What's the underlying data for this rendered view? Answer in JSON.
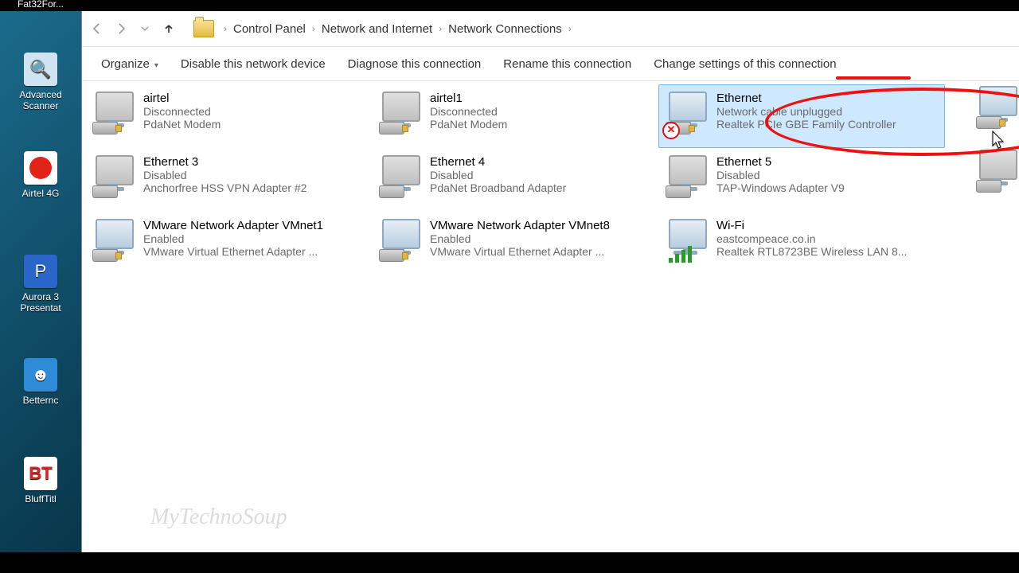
{
  "desktop_icons": [
    {
      "label": "Fat32For..."
    },
    {
      "label": "Advanced Scanner"
    },
    {
      "label": "Airtel 4G"
    },
    {
      "label": "Aurora 3 Presentat"
    },
    {
      "label": "Betternc"
    },
    {
      "label": "BluffTitl"
    }
  ],
  "breadcrumbs": [
    "Control Panel",
    "Network and Internet",
    "Network Connections"
  ],
  "toolbar": {
    "organize": "Organize",
    "disable": "Disable this network device",
    "diagnose": "Diagnose this connection",
    "rename": "Rename this connection",
    "change": "Change settings of this connection"
  },
  "connections": [
    {
      "name": "airtel",
      "status": "Disconnected",
      "device": "PdaNet Modem",
      "kind": "disconnected"
    },
    {
      "name": "airtel1",
      "status": "Disconnected",
      "device": "PdaNet Modem",
      "kind": "disconnected"
    },
    {
      "name": "Ethernet",
      "status": "Network cable unplugged",
      "device": "Realtek PCIe GBE Family Controller",
      "kind": "unplugged",
      "selected": true
    },
    {
      "name": "Ethernet 3",
      "status": "Disabled",
      "device": "Anchorfree HSS VPN Adapter #2",
      "kind": "disabled"
    },
    {
      "name": "Ethernet 4",
      "status": "Disabled",
      "device": "PdaNet Broadband Adapter",
      "kind": "disabled"
    },
    {
      "name": "Ethernet 5",
      "status": "Disabled",
      "device": "TAP-Windows Adapter V9",
      "kind": "disabled"
    },
    {
      "name": "VMware Network Adapter VMnet1",
      "status": "Enabled",
      "device": "VMware Virtual Ethernet Adapter ...",
      "kind": "enabled"
    },
    {
      "name": "VMware Network Adapter VMnet8",
      "status": "Enabled",
      "device": "VMware Virtual Ethernet Adapter ...",
      "kind": "enabled"
    },
    {
      "name": "Wi-Fi",
      "status": "eastcompeace.co.in",
      "device": "Realtek RTL8723BE Wireless LAN 8...",
      "kind": "wifi"
    }
  ],
  "watermark": "MyTechnoSoup"
}
